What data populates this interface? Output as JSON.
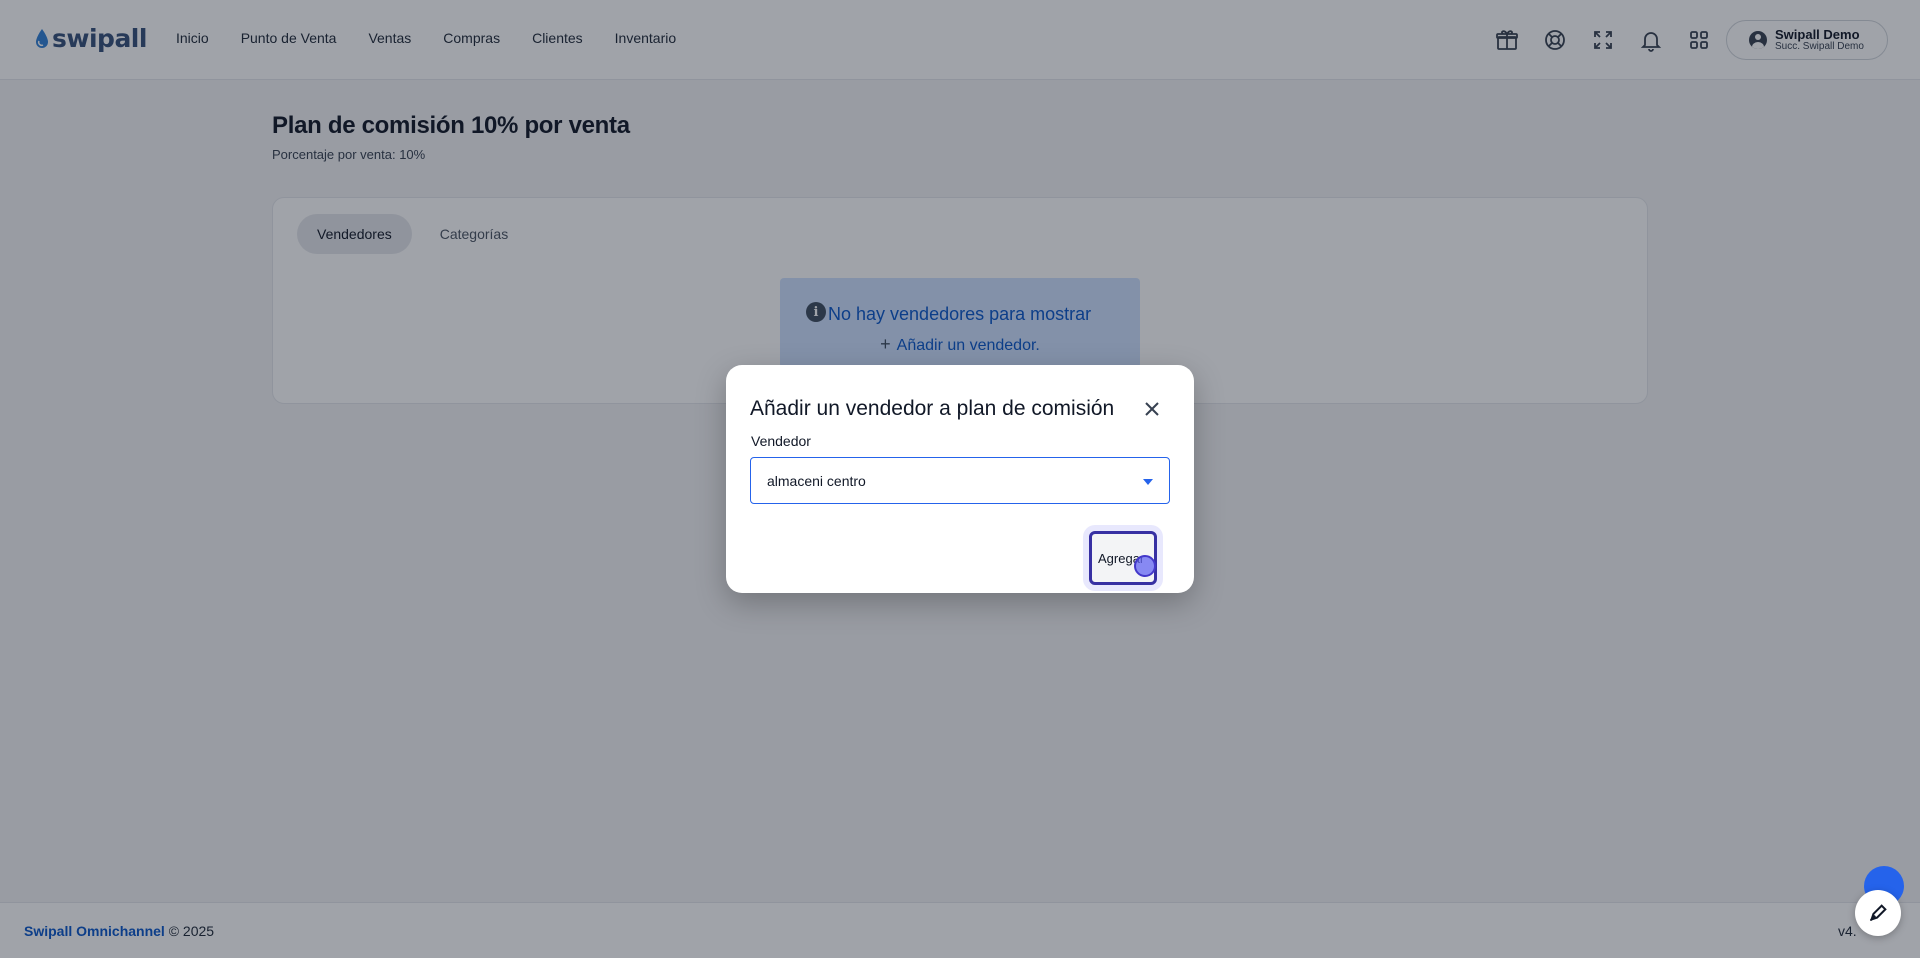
{
  "header": {
    "logo_text": "swipall",
    "nav": [
      "Inicio",
      "Punto de Venta",
      "Ventas",
      "Compras",
      "Clientes",
      "Inventario"
    ],
    "icons": [
      "gift-icon",
      "lifebuoy-icon",
      "fullscreen-icon",
      "bell-icon",
      "apps-grid-icon"
    ],
    "user": {
      "name": "Swipall Demo",
      "subtitle": "Succ. Swipall Demo"
    }
  },
  "page": {
    "title": "Plan de comisión 10% por venta",
    "subtitle": "Porcentaje por venta: 10%",
    "tabs": [
      {
        "label": "Vendedores",
        "active": true
      },
      {
        "label": "Categorías",
        "active": false
      }
    ],
    "alert": {
      "title": "No hay vendedores para mostrar",
      "link": "Añadir un vendedor."
    }
  },
  "modal": {
    "title": "Añadir un vendedor a plan de comisión",
    "field_label": "Vendedor",
    "selected_value": "almaceni centro",
    "add_button": "Agregar"
  },
  "footer": {
    "brand": "Swipall Omnichannel",
    "copyright": "© 2025",
    "version": "v4."
  },
  "colors": {
    "accent": "#0a58ca",
    "focus": "#2563eb",
    "button_border": "#3730a3"
  }
}
